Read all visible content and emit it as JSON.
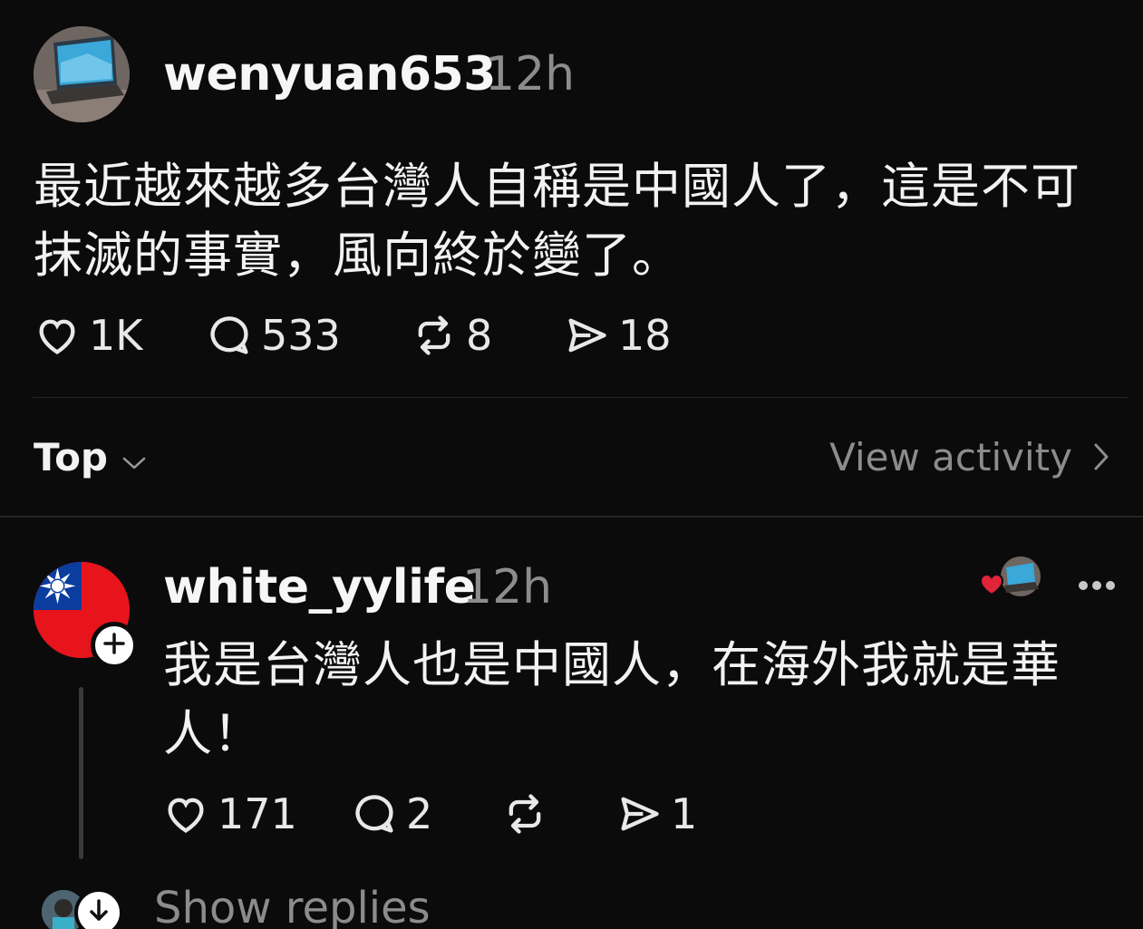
{
  "post": {
    "username": "wenyuan653",
    "timestamp": "12h",
    "text": "最近越來越多台灣人自稱是中國人了，這是不可抹滅的事實，風向終於變了。",
    "likes": "1K",
    "comments": "533",
    "reposts": "8",
    "shares": "18"
  },
  "sort": {
    "label": "Top",
    "view_activity": "View activity"
  },
  "reply": {
    "username": "white_yylife",
    "timestamp": "12h",
    "text": "我是台灣人也是中國人，在海外我就是華人！",
    "likes": "171",
    "comments": "2",
    "reposts": "",
    "shares": "1"
  },
  "show_replies": "Show replies",
  "colors": {
    "background": "#0b0b0b",
    "heart": "#e0243a",
    "muted": "#8c8c8c"
  },
  "icons": [
    "heart-icon",
    "comment-icon",
    "repost-icon",
    "share-icon",
    "chevron-down-icon",
    "chevron-right-icon",
    "more-icon",
    "plus-icon",
    "arrow-down-icon"
  ]
}
